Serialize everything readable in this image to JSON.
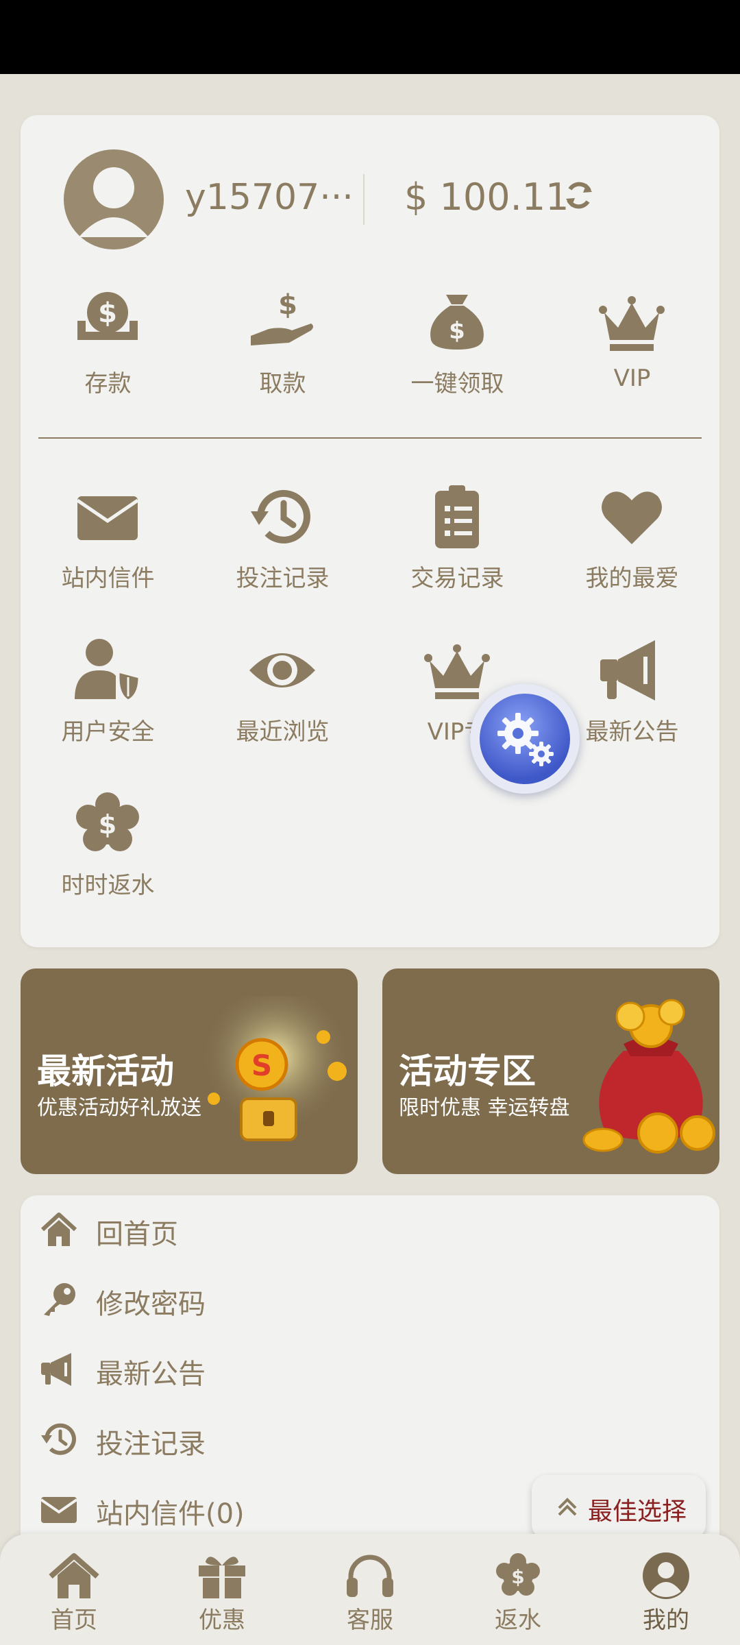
{
  "user": {
    "username": "y15707···",
    "balance": "$ 100.11"
  },
  "quick_actions": [
    {
      "label": "存款",
      "icon": "deposit-icon"
    },
    {
      "label": "取款",
      "icon": "withdraw-icon"
    },
    {
      "label": "一键领取",
      "icon": "money-bag-icon"
    },
    {
      "label": "VIP",
      "icon": "crown-icon"
    }
  ],
  "features": [
    {
      "label": "站内信件",
      "icon": "envelope-icon"
    },
    {
      "label": "投注记录",
      "icon": "history-icon"
    },
    {
      "label": "交易记录",
      "icon": "clipboard-list-icon"
    },
    {
      "label": "我的最爱",
      "icon": "heart-icon"
    },
    {
      "label": "用户安全",
      "icon": "user-shield-icon"
    },
    {
      "label": "最近浏览",
      "icon": "eye-icon"
    },
    {
      "label": "VIP专",
      "icon": "crown-icon"
    },
    {
      "label": "最新公告",
      "icon": "megaphone-icon"
    },
    {
      "label": "时时返水",
      "icon": "cashback-icon"
    }
  ],
  "banners": [
    {
      "title": "最新活动",
      "subtitle": "优惠活动好礼放送",
      "icon": "treasure-chest-icon"
    },
    {
      "title": "活动专区",
      "subtitle": "限时优惠 幸运转盘",
      "icon": "coin-bag-icon"
    }
  ],
  "menu": [
    {
      "label": "回首页",
      "icon": "home-icon"
    },
    {
      "label": "修改密码",
      "icon": "key-icon"
    },
    {
      "label": "最新公告",
      "icon": "megaphone-icon"
    },
    {
      "label": "投注记录",
      "icon": "history-icon"
    },
    {
      "label": "站内信件(0)",
      "icon": "envelope-icon"
    }
  ],
  "best_choice": {
    "label": "最佳选择",
    "icon": "chevron-up-double-icon"
  },
  "tabbar": [
    {
      "label": "首页",
      "icon": "home-icon"
    },
    {
      "label": "优惠",
      "icon": "gift-icon"
    },
    {
      "label": "客服",
      "icon": "headset-icon"
    },
    {
      "label": "返水",
      "icon": "cashback-icon"
    },
    {
      "label": "我的",
      "icon": "user-circle-icon",
      "active": true
    }
  ],
  "colors": {
    "accent": "#8b7b60",
    "banner_bg": "#7e6c4d",
    "page_bg": "#e4e1d8",
    "best_text": "#8b2020"
  }
}
